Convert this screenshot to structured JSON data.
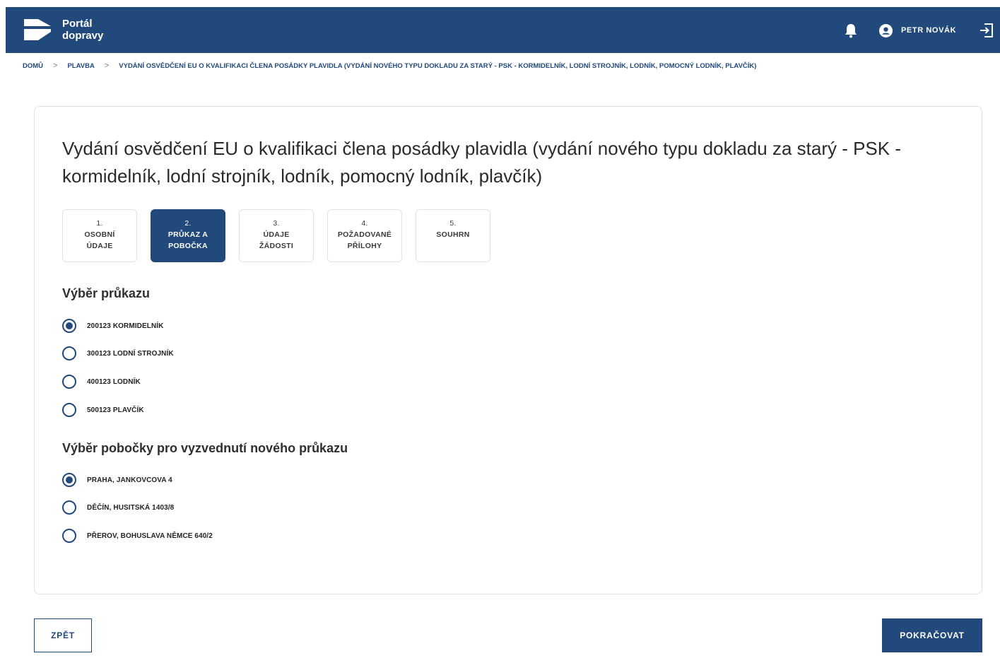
{
  "header": {
    "brand_line1": "Portál",
    "brand_line2": "dopravy",
    "user_name": "PETR NOVÁK",
    "icons": [
      "logo-icon",
      "bell-icon",
      "user-avatar-icon",
      "logout-icon"
    ]
  },
  "breadcrumb": {
    "items": [
      "DOMŮ",
      "PLAVBA",
      "VYDÁNÍ OSVĚDČENÍ EU O KVALIFIKACI ČLENA POSÁDKY PLAVIDLA (VYDÁNÍ NOVÉHO TYPU DOKLADU ZA STARÝ - PSK - KORMIDELNÍK, LODNÍ STROJNÍK, LODNÍK, POMOCNÝ LODNÍK, PLAVČÍK)"
    ],
    "separator": ">"
  },
  "main": {
    "title": "Vydání osvědčení EU o kvalifikaci člena posádky plavidla (vydání nového typu dokladu za starý - PSK - kormidelník, lodní strojník, lodník, pomocný lodník, plavčík)",
    "steps": [
      {
        "num": "1.",
        "label1": "OSOBNÍ",
        "label2": "ÚDAJE",
        "active": false
      },
      {
        "num": "2.",
        "label1": "PRŮKAZ A",
        "label2": "POBOČKA",
        "active": true
      },
      {
        "num": "3.",
        "label1": "ÚDAJE",
        "label2": "ŽÁDOSTI",
        "active": false
      },
      {
        "num": "4.",
        "label1": "POŽADOVANÉ",
        "label2": "PŘÍLOHY",
        "active": false
      },
      {
        "num": "5.",
        "label1": "SOUHRN",
        "label2": "",
        "active": false
      }
    ],
    "card_section": {
      "title": "Výběr průkazu",
      "options": [
        {
          "label": "200123 KORMIDELNÍK",
          "checked": true
        },
        {
          "label": "300123 LODNÍ STROJNÍK",
          "checked": false
        },
        {
          "label": "400123 LODNÍK",
          "checked": false
        },
        {
          "label": "500123 PLAVČÍK",
          "checked": false
        }
      ]
    },
    "branch_section": {
      "title": "Výběr pobočky pro vyzvednutí nového průkazu",
      "options": [
        {
          "label": "PRAHA, JANKOVCOVA 4",
          "checked": true
        },
        {
          "label": "DĚČÍN, HUSITSKÁ 1403/8",
          "checked": false
        },
        {
          "label": "PŘEROV, BOHUSLAVA NĚMCE 640/2",
          "checked": false
        }
      ]
    }
  },
  "footer": {
    "back_label": "ZPĚT",
    "next_label": "POKRAČOVAT"
  },
  "colors": {
    "primary": "#22497c",
    "border": "#dfe3e8"
  }
}
